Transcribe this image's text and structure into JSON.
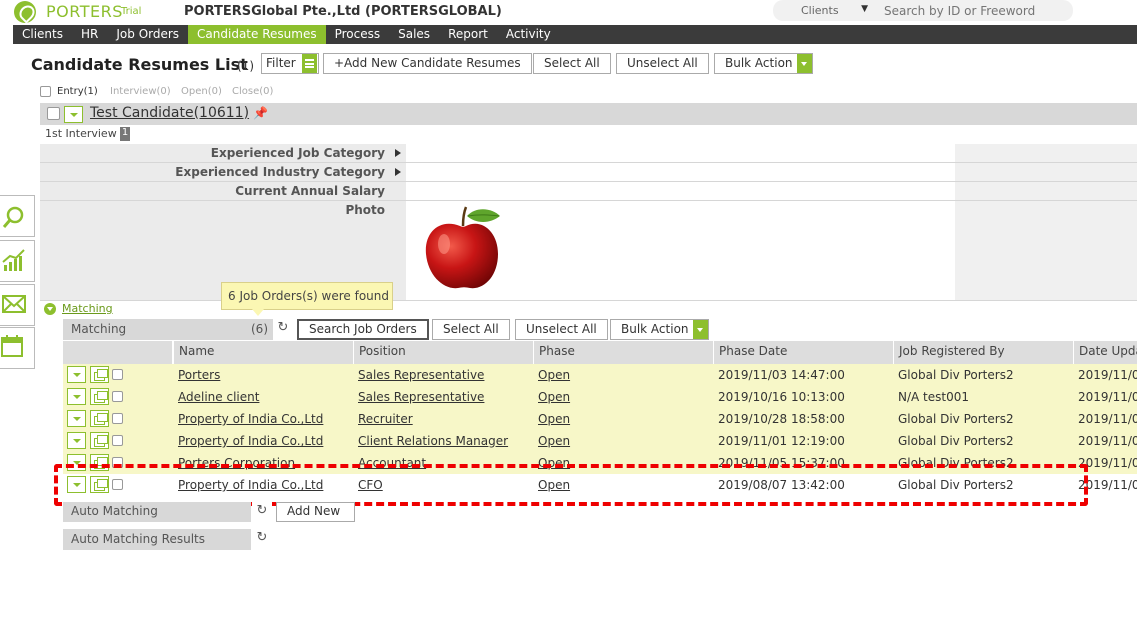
{
  "app": {
    "logo_text": "PORTERS",
    "trial": "Trial",
    "company": "PORTERSGlobal Pte.,Ltd (PORTERSGLOBAL)"
  },
  "search": {
    "scope": "Clients",
    "placeholder": "Search by ID or Freeword"
  },
  "nav": [
    {
      "label": "Clients"
    },
    {
      "label": "HR"
    },
    {
      "label": "Job Orders"
    },
    {
      "label": "Candidate Resumes",
      "active": true
    },
    {
      "label": "Process"
    },
    {
      "label": "Sales"
    },
    {
      "label": "Report"
    },
    {
      "label": "Activity"
    }
  ],
  "page": {
    "title": "Candidate Resumes List",
    "count": "(1)",
    "filter": "Filter",
    "add_new": "+Add New Candidate Resumes",
    "select_all": "Select All",
    "unselect_all": "Unselect All",
    "bulk_action": "Bulk Action"
  },
  "status_tabs": {
    "entry": "Entry(1)",
    "interview": "Interview(0)",
    "open": "Open(0)",
    "close": "Close(0)"
  },
  "candidate": {
    "name": "Test Candidate(10611)",
    "stage": "1st Interview",
    "stage_count": "1",
    "fields": {
      "job_category": "Experienced Job Category",
      "industry_category": "Experienced Industry Category",
      "annual_salary": "Current Annual Salary",
      "photo": "Photo"
    }
  },
  "matching": {
    "toggle_label": "Matching",
    "tooltip": "6 Job Orders(s) were found",
    "bar_label": "Matching",
    "bar_count": "(6)",
    "search_job_orders": "Search Job Orders",
    "select_all": "Select All",
    "unselect_all": "Unselect All",
    "bulk_action": "Bulk Action",
    "columns": [
      "Name",
      "Position",
      "Phase",
      "Phase Date",
      "Job Registered By",
      "Date Upda"
    ],
    "rows": [
      {
        "name": "Porters",
        "position": "Sales Representative",
        "phase": "Open",
        "phase_date": "2019/11/03 14:47:00",
        "registered_by": "Global Div Porters2",
        "date_updated": "2019/11/0"
      },
      {
        "name": "Adeline client",
        "position": "Sales Representative",
        "phase": "Open",
        "phase_date": "2019/10/16 10:13:00",
        "registered_by": "N/A test001",
        "date_updated": "2019/11/0"
      },
      {
        "name": "Property of India Co.,Ltd",
        "position": "Recruiter",
        "phase": "Open",
        "phase_date": "2019/10/28 18:58:00",
        "registered_by": "Global Div Porters2",
        "date_updated": "2019/11/0"
      },
      {
        "name": "Property of India Co.,Ltd",
        "position": "Client Relations Manager",
        "phase": "Open",
        "phase_date": "2019/11/01 12:19:00",
        "registered_by": "Global Div Porters2",
        "date_updated": "2019/11/0"
      },
      {
        "name": "Porters Corporation",
        "position": "Accountant",
        "phase": "Open",
        "phase_date": "2019/11/05 15:37:00",
        "registered_by": "Global Div Porters2",
        "date_updated": "2019/11/0"
      },
      {
        "name": "Property of India Co.,Ltd",
        "position": "CFO",
        "phase": "Open",
        "phase_date": "2019/08/07 13:42:00",
        "registered_by": "Global Div Porters2",
        "date_updated": "2019/11/0"
      }
    ],
    "auto_matching": "Auto Matching",
    "add_new": "Add New",
    "auto_matching_results": "Auto Matching Results"
  },
  "colors": {
    "brand": "#8dbf2e",
    "nav_bg": "#3b3b3b",
    "highlight_row": "#f7f7c8",
    "annotation": "#e00000"
  }
}
